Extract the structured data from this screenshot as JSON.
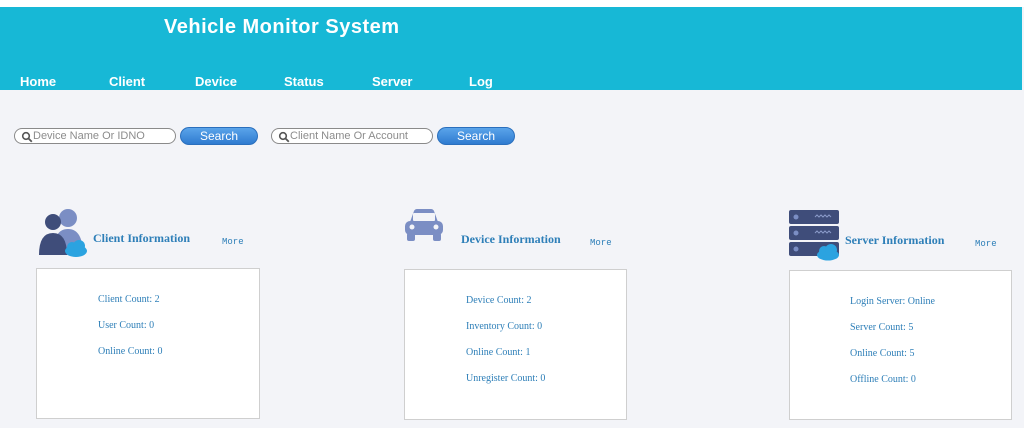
{
  "app": {
    "title": "Vehicle Monitor System"
  },
  "nav": [
    {
      "label": "Home"
    },
    {
      "label": "Client"
    },
    {
      "label": "Device"
    },
    {
      "label": "Status"
    },
    {
      "label": "Server"
    },
    {
      "label": "Log"
    }
  ],
  "search": [
    {
      "placeholder": "Device Name Or IDNO",
      "button_label": "Search"
    },
    {
      "placeholder": "Client Name Or Account",
      "button_label": "Search"
    }
  ],
  "panels": {
    "client": {
      "title": "Client Information",
      "more": "More",
      "icon": "users-icon",
      "stats": [
        "Client Count: 2",
        "User Count: 0",
        "Online Count: 0"
      ]
    },
    "device": {
      "title": "Device Information",
      "more": "More",
      "icon": "car-icon",
      "stats": [
        "Device Count: 2",
        "Inventory Count: 0",
        "Online Count: 1",
        "Unregister Count: 0"
      ]
    },
    "server": {
      "title": "Server Information",
      "more": "More",
      "icon": "server-icon",
      "stats": [
        "Login Server: Online",
        "Server Count: 5",
        "Online Count: 5",
        "Offline Count: 0"
      ]
    }
  },
  "colors": {
    "header": "#17b8d6",
    "accent_text": "#2e7fb8",
    "button": "#2f7bd0",
    "background": "#f3f4f8"
  }
}
